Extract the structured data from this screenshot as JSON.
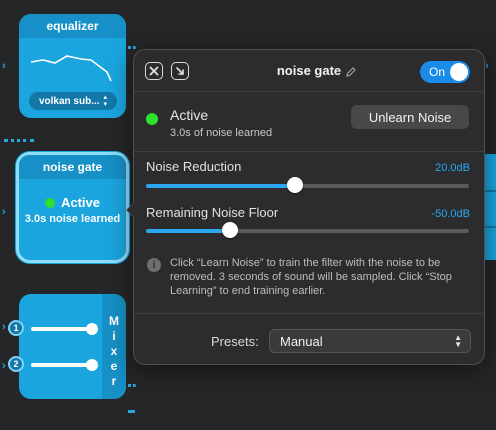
{
  "equalizer": {
    "title": "equalizer",
    "preset": "volkan sub..."
  },
  "noise_gate_node": {
    "title": "noise gate",
    "status": "Active",
    "learned": "3.0s noise learned"
  },
  "mixer": {
    "letters": [
      "M",
      "i",
      "x",
      "e",
      "r"
    ],
    "inputs": [
      {
        "badge": "1"
      },
      {
        "badge": "2"
      }
    ]
  },
  "popover": {
    "title": "noise gate",
    "toggle_label": "On",
    "status": "Active",
    "status_detail": "3.0s of noise learned",
    "unlearn_button": "Unlearn Noise",
    "noise_reduction": {
      "label": "Noise Reduction",
      "value": "20.0dB",
      "fraction": 0.46
    },
    "noise_floor": {
      "label": "Remaining Noise Floor",
      "value": "-50.0dB",
      "fraction": 0.26
    },
    "info": "Click “Learn Noise” to train the filter with the noise to be removed. 3 seconds of sound will be sampled. Click “Stop Learning” to end training earlier.",
    "presets_label": "Presets:",
    "presets_value": "Manual"
  },
  "colors": {
    "node_blue": "#1aa5df",
    "accent_blue": "#2aa7f0",
    "active_green": "#2be12b",
    "panel_bg": "#2c2c2e"
  }
}
